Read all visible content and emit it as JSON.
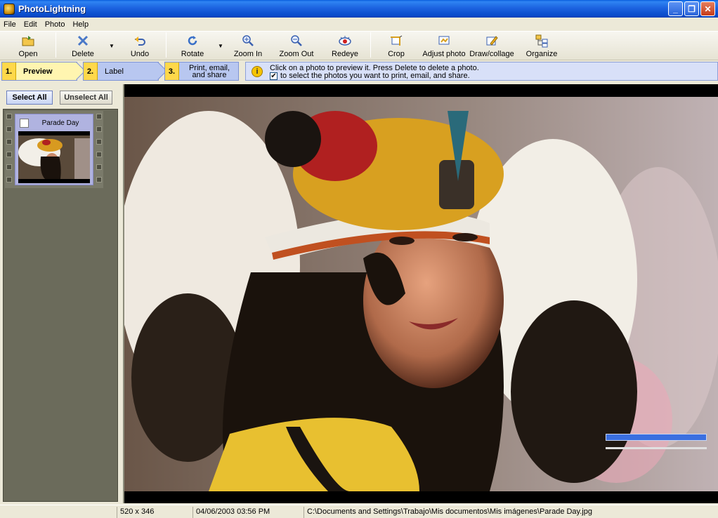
{
  "window": {
    "title": "PhotoLightning"
  },
  "menu": [
    "File",
    "Edit",
    "Photo",
    "Help"
  ],
  "toolbar": {
    "open": "Open",
    "delete": "Delete",
    "undo": "Undo",
    "rotate": "Rotate",
    "zoom_in": "Zoom In",
    "zoom_out": "Zoom Out",
    "redeye": "Redeye",
    "crop": "Crop",
    "adjust": "Adjust photo",
    "draw": "Draw/collage",
    "organize": "Organize"
  },
  "steps": [
    {
      "num": "1.",
      "label": "Preview"
    },
    {
      "num": "2.",
      "label": "Label"
    },
    {
      "num": "3.",
      "line1": "Print, email,",
      "line2": "and share"
    }
  ],
  "info": {
    "line1": "Click on a photo to preview it.  Press Delete to delete a photo.",
    "line2": "to select the photos you want to print, email, and share.",
    "check_mark": "✔"
  },
  "selection": {
    "select_all": "Select All",
    "unselect_all": "Unselect All"
  },
  "thumbnails": [
    {
      "title": "Parade Day"
    }
  ],
  "status": {
    "dimensions": "520 x 346",
    "datetime": "04/06/2003  03:56 PM",
    "path": "C:\\Documents and Settings\\Trabajo\\Mis documentos\\Mis imágenes\\Parade Day.jpg"
  }
}
